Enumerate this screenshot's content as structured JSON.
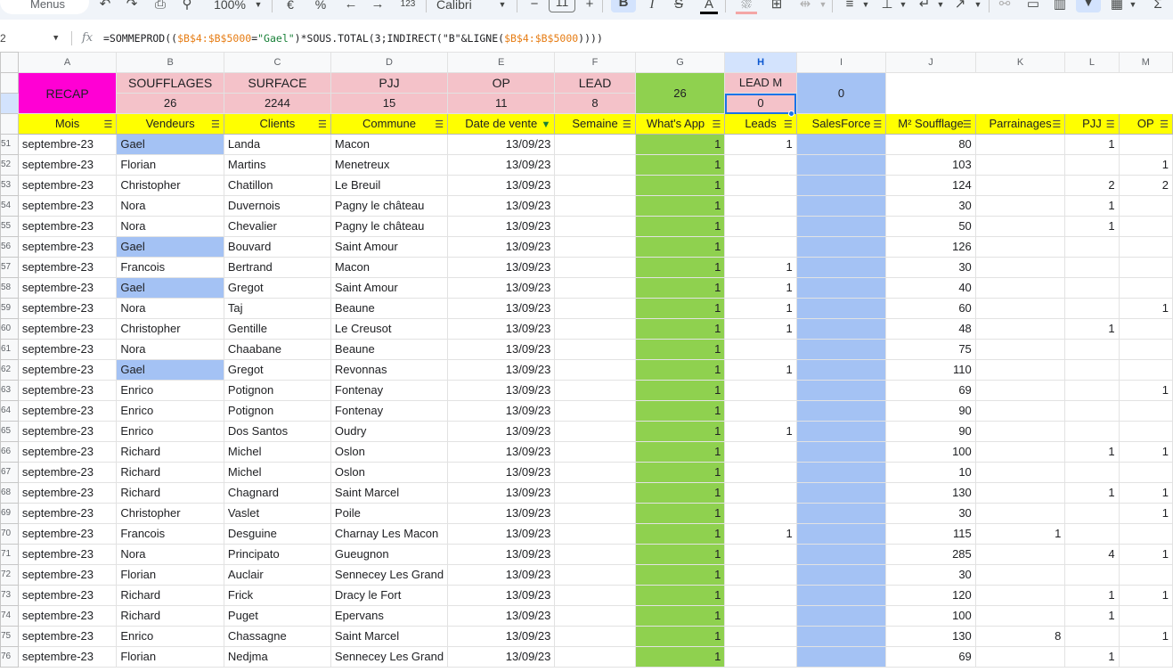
{
  "toolbar": {
    "search_label": "Menus",
    "zoom": "100%",
    "currency": "€",
    "percent": "%",
    "number_format": "123",
    "font_name": "Calibri",
    "font_size": "11",
    "bold": "B",
    "italic": "I"
  },
  "formula_bar": {
    "cell_ref": "2",
    "fx": "fx",
    "formula_parts": [
      "=SOMMEPROD((",
      "$B$4:$B$5000",
      "=",
      "\"Gael\"",
      ")*SOUS.TOTAL(3;INDIRECT(\"B\"&LIGNE(",
      "$B$4:$B$5000",
      "))))"
    ]
  },
  "columns": [
    "A",
    "B",
    "C",
    "D",
    "E",
    "F",
    "G",
    "H",
    "I",
    "J",
    "K",
    "L",
    "M"
  ],
  "summary": {
    "recap": "RECAP",
    "souff_label": "SOUFFLAGES",
    "souff_value": "26",
    "surface_label": "SURFACE",
    "surface_value": "2244",
    "pjj_label": "PJJ",
    "pjj_value": "15",
    "op_label": "OP",
    "op_value": "11",
    "lead_label": "LEAD",
    "lead_value": "8",
    "whatsapp_total": "26",
    "leadm_label": "LEAD M",
    "leadm_value": "0",
    "salesforce_total": "0"
  },
  "headers": [
    "Mois",
    "Vendeurs",
    "Clients",
    "Commune",
    "Date de vente",
    "Semaine",
    "What's App",
    "Leads",
    "SalesForce",
    "M² Soufflage",
    "Parrainages",
    "PJJ",
    "OP"
  ],
  "rows": [
    {
      "n": "51",
      "mois": "septembre-23",
      "vendeur": "Gael",
      "client": "Landa",
      "commune": "Macon",
      "date": "13/09/23",
      "wa": "1",
      "leads": "1",
      "m2": "80",
      "parr": "",
      "pjj": "1",
      "op": ""
    },
    {
      "n": "52",
      "mois": "septembre-23",
      "vendeur": "Florian",
      "client": "Martins",
      "commune": "Menetreux",
      "date": "13/09/23",
      "wa": "1",
      "leads": "",
      "m2": "103",
      "parr": "",
      "pjj": "",
      "op": "1"
    },
    {
      "n": "53",
      "mois": "septembre-23",
      "vendeur": "Christopher",
      "client": "Chatillon",
      "commune": "Le Breuil",
      "date": "13/09/23",
      "wa": "1",
      "leads": "",
      "m2": "124",
      "parr": "",
      "pjj": "2",
      "op": "2"
    },
    {
      "n": "54",
      "mois": "septembre-23",
      "vendeur": "Nora",
      "client": "Duvernois",
      "commune": "Pagny le château",
      "date": "13/09/23",
      "wa": "1",
      "leads": "",
      "m2": "30",
      "parr": "",
      "pjj": "1",
      "op": ""
    },
    {
      "n": "55",
      "mois": "septembre-23",
      "vendeur": "Nora",
      "client": "Chevalier",
      "commune": "Pagny le château",
      "date": "13/09/23",
      "wa": "1",
      "leads": "",
      "m2": "50",
      "parr": "",
      "pjj": "1",
      "op": ""
    },
    {
      "n": "56",
      "mois": "septembre-23",
      "vendeur": "Gael",
      "client": "Bouvard",
      "commune": "Saint Amour",
      "date": "13/09/23",
      "wa": "1",
      "leads": "",
      "m2": "126",
      "parr": "",
      "pjj": "",
      "op": ""
    },
    {
      "n": "57",
      "mois": "septembre-23",
      "vendeur": "Francois",
      "client": "Bertrand",
      "commune": "Macon",
      "date": "13/09/23",
      "wa": "1",
      "leads": "1",
      "m2": "30",
      "parr": "",
      "pjj": "",
      "op": ""
    },
    {
      "n": "58",
      "mois": "septembre-23",
      "vendeur": "Gael",
      "client": "Gregot",
      "commune": "Saint Amour",
      "date": "13/09/23",
      "wa": "1",
      "leads": "1",
      "m2": "40",
      "parr": "",
      "pjj": "",
      "op": ""
    },
    {
      "n": "59",
      "mois": "septembre-23",
      "vendeur": "Nora",
      "client": "Taj",
      "commune": "Beaune",
      "date": "13/09/23",
      "wa": "1",
      "leads": "1",
      "m2": "60",
      "parr": "",
      "pjj": "",
      "op": "1"
    },
    {
      "n": "60",
      "mois": "septembre-23",
      "vendeur": "Christopher",
      "client": "Gentille",
      "commune": "Le Creusot",
      "date": "13/09/23",
      "wa": "1",
      "leads": "1",
      "m2": "48",
      "parr": "",
      "pjj": "1",
      "op": ""
    },
    {
      "n": "61",
      "mois": "septembre-23",
      "vendeur": "Nora",
      "client": "Chaabane",
      "commune": "Beaune",
      "date": "13/09/23",
      "wa": "1",
      "leads": "",
      "m2": "75",
      "parr": "",
      "pjj": "",
      "op": ""
    },
    {
      "n": "62",
      "mois": "septembre-23",
      "vendeur": "Gael",
      "client": "Gregot",
      "commune": "Revonnas",
      "date": "13/09/23",
      "wa": "1",
      "leads": "1",
      "m2": "110",
      "parr": "",
      "pjj": "",
      "op": ""
    },
    {
      "n": "63",
      "mois": "septembre-23",
      "vendeur": "Enrico",
      "client": "Potignon",
      "commune": "Fontenay",
      "date": "13/09/23",
      "wa": "1",
      "leads": "",
      "m2": "69",
      "parr": "",
      "pjj": "",
      "op": "1"
    },
    {
      "n": "64",
      "mois": "septembre-23",
      "vendeur": "Enrico",
      "client": "Potignon",
      "commune": "Fontenay",
      "date": "13/09/23",
      "wa": "1",
      "leads": "",
      "m2": "90",
      "parr": "",
      "pjj": "",
      "op": ""
    },
    {
      "n": "65",
      "mois": "septembre-23",
      "vendeur": "Enrico",
      "client": "Dos Santos",
      "commune": "Oudry",
      "date": "13/09/23",
      "wa": "1",
      "leads": "1",
      "m2": "90",
      "parr": "",
      "pjj": "",
      "op": ""
    },
    {
      "n": "66",
      "mois": "septembre-23",
      "vendeur": "Richard",
      "client": "Michel",
      "commune": "Oslon",
      "date": "13/09/23",
      "wa": "1",
      "leads": "",
      "m2": "100",
      "parr": "",
      "pjj": "1",
      "op": "1"
    },
    {
      "n": "67",
      "mois": "septembre-23",
      "vendeur": "Richard",
      "client": "Michel",
      "commune": "Oslon",
      "date": "13/09/23",
      "wa": "1",
      "leads": "",
      "m2": "10",
      "parr": "",
      "pjj": "",
      "op": ""
    },
    {
      "n": "68",
      "mois": "septembre-23",
      "vendeur": "Richard",
      "client": "Chagnard",
      "commune": "Saint Marcel",
      "date": "13/09/23",
      "wa": "1",
      "leads": "",
      "m2": "130",
      "parr": "",
      "pjj": "1",
      "op": "1"
    },
    {
      "n": "69",
      "mois": "septembre-23",
      "vendeur": "Christopher",
      "client": "Vaslet",
      "commune": "Poile",
      "date": "13/09/23",
      "wa": "1",
      "leads": "",
      "m2": "30",
      "parr": "",
      "pjj": "",
      "op": "1"
    },
    {
      "n": "70",
      "mois": "septembre-23",
      "vendeur": "Francois",
      "client": "Desguine",
      "commune": "Charnay Les Macon",
      "date": "13/09/23",
      "wa": "1",
      "leads": "1",
      "m2": "115",
      "parr": "1",
      "pjj": "",
      "op": ""
    },
    {
      "n": "71",
      "mois": "septembre-23",
      "vendeur": "Nora",
      "client": "Principato",
      "commune": "Gueugnon",
      "date": "13/09/23",
      "wa": "1",
      "leads": "",
      "m2": "285",
      "parr": "",
      "pjj": "4",
      "op": "1"
    },
    {
      "n": "72",
      "mois": "septembre-23",
      "vendeur": "Florian",
      "client": "Auclair",
      "commune": "Sennecey Les Grand",
      "date": "13/09/23",
      "wa": "1",
      "leads": "",
      "m2": "30",
      "parr": "",
      "pjj": "",
      "op": ""
    },
    {
      "n": "73",
      "mois": "septembre-23",
      "vendeur": "Richard",
      "client": "Frick",
      "commune": "Dracy le Fort",
      "date": "13/09/23",
      "wa": "1",
      "leads": "",
      "m2": "120",
      "parr": "",
      "pjj": "1",
      "op": "1"
    },
    {
      "n": "74",
      "mois": "septembre-23",
      "vendeur": "Richard",
      "client": "Puget",
      "commune": "Epervans",
      "date": "13/09/23",
      "wa": "1",
      "leads": "",
      "m2": "100",
      "parr": "",
      "pjj": "1",
      "op": ""
    },
    {
      "n": "75",
      "mois": "septembre-23",
      "vendeur": "Enrico",
      "client": "Chassagne",
      "commune": "Saint Marcel",
      "date": "13/09/23",
      "wa": "1",
      "leads": "",
      "m2": "130",
      "parr": "8",
      "pjj": "",
      "op": "1"
    },
    {
      "n": "76",
      "mois": "septembre-23",
      "vendeur": "Florian",
      "client": "Nedjma",
      "commune": "Sennecey Les Grand",
      "date": "13/09/23",
      "wa": "1",
      "leads": "",
      "m2": "69",
      "parr": "",
      "pjj": "1",
      "op": ""
    }
  ]
}
